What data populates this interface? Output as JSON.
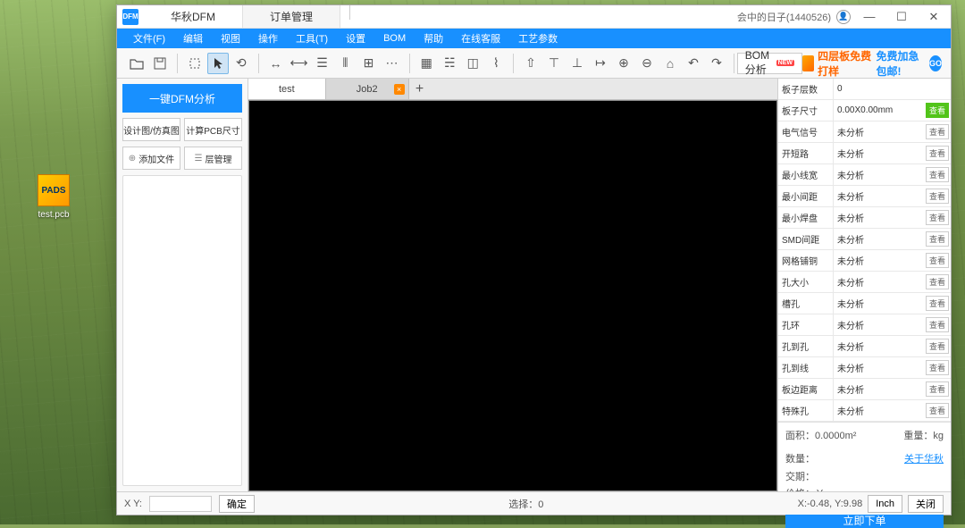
{
  "desktop": {
    "icon_label": "test.pcb",
    "icon_badge": "PADS"
  },
  "title": {
    "app_name": "华秋DFM",
    "tab2": "订单管理",
    "user_info": "会中的日子(1440526)"
  },
  "menu": {
    "file": "文件(F)",
    "edit": "编辑",
    "view": "视图",
    "operate": "操作",
    "tools": "工具(T)",
    "settings": "设置",
    "bom": "BOM",
    "help": "帮助",
    "online": "在线客服",
    "process": "工艺参数"
  },
  "toolbar": {
    "bom_analyze": "BOM分析",
    "new_badge": "NEW",
    "promo1": "四层板免费打样",
    "promo2": "免费加急包邮!",
    "go": "GO"
  },
  "left": {
    "dfm_btn": "一键DFM分析",
    "design_sim": "设计图/仿真图",
    "calc_pcb": "计算PCB尺寸",
    "add_file": "添加文件",
    "layer_mgmt": "层管理"
  },
  "tabs": {
    "tab1": "test",
    "tab2": "Job2"
  },
  "props": [
    {
      "label": "板子层数",
      "value": "0",
      "action": ""
    },
    {
      "label": "板子尺寸",
      "value": "0.00X0.00mm",
      "action": "查看",
      "green": true
    },
    {
      "label": "电气信号",
      "value": "未分析",
      "action": "查看"
    },
    {
      "label": "开短路",
      "value": "未分析",
      "action": "查看"
    },
    {
      "label": "最小线宽",
      "value": "未分析",
      "action": "查看"
    },
    {
      "label": "最小间距",
      "value": "未分析",
      "action": "查看"
    },
    {
      "label": "最小焊盘",
      "value": "未分析",
      "action": "查看"
    },
    {
      "label": "SMD间距",
      "value": "未分析",
      "action": "查看"
    },
    {
      "label": "网格铺铜",
      "value": "未分析",
      "action": "查看"
    },
    {
      "label": "孔大小",
      "value": "未分析",
      "action": "查看"
    },
    {
      "label": "槽孔",
      "value": "未分析",
      "action": "查看"
    },
    {
      "label": "孔环",
      "value": "未分析",
      "action": "查看"
    },
    {
      "label": "孔到孔",
      "value": "未分析",
      "action": "查看"
    },
    {
      "label": "孔到线",
      "value": "未分析",
      "action": "查看"
    },
    {
      "label": "板边距离",
      "value": "未分析",
      "action": "查看"
    },
    {
      "label": "特殊孔",
      "value": "未分析",
      "action": "查看"
    }
  ],
  "right_info": {
    "area": "面积：0.0000m²",
    "weight": "重量：kg",
    "qty": "数量：",
    "about": "关于华秋",
    "delivery": "交期：",
    "price": "价格：￥",
    "order_btn": "立即下单"
  },
  "status": {
    "xy_label": "X Y:",
    "confirm": "确定",
    "selection": "选择：0",
    "coords": "X:-0.48, Y:9.98",
    "unit": "Inch",
    "close": "关闭"
  }
}
